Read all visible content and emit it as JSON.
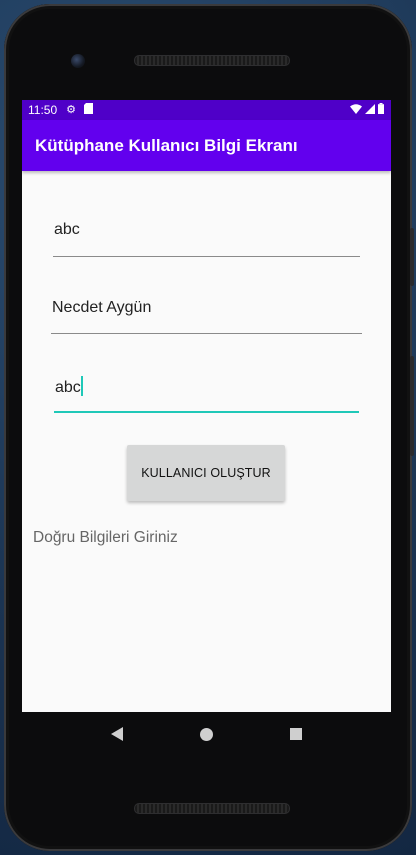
{
  "status_bar": {
    "time": "11:50",
    "icons": [
      "gear-icon",
      "sd-card-icon"
    ],
    "right_icons": [
      "wifi-icon",
      "signal-icon",
      "battery-icon"
    ]
  },
  "app_bar": {
    "title": "Kütüphane Kullanıcı Bilgi Ekranı"
  },
  "form": {
    "field1_value": "abc",
    "field2_value": "Necdet Aygün",
    "field3_value": "abc"
  },
  "button": {
    "label": "KULLANICI OLUŞTUR"
  },
  "message": "Doğru Bilgileri Giriniz",
  "nav_bar": {
    "icons": [
      "back-icon",
      "home-icon",
      "recents-icon"
    ]
  },
  "colors": {
    "status_bar": "#4f00c8",
    "app_bar": "#6200ee",
    "focus_accent": "#1fc8b8",
    "screen_bg": "#fafafa"
  }
}
